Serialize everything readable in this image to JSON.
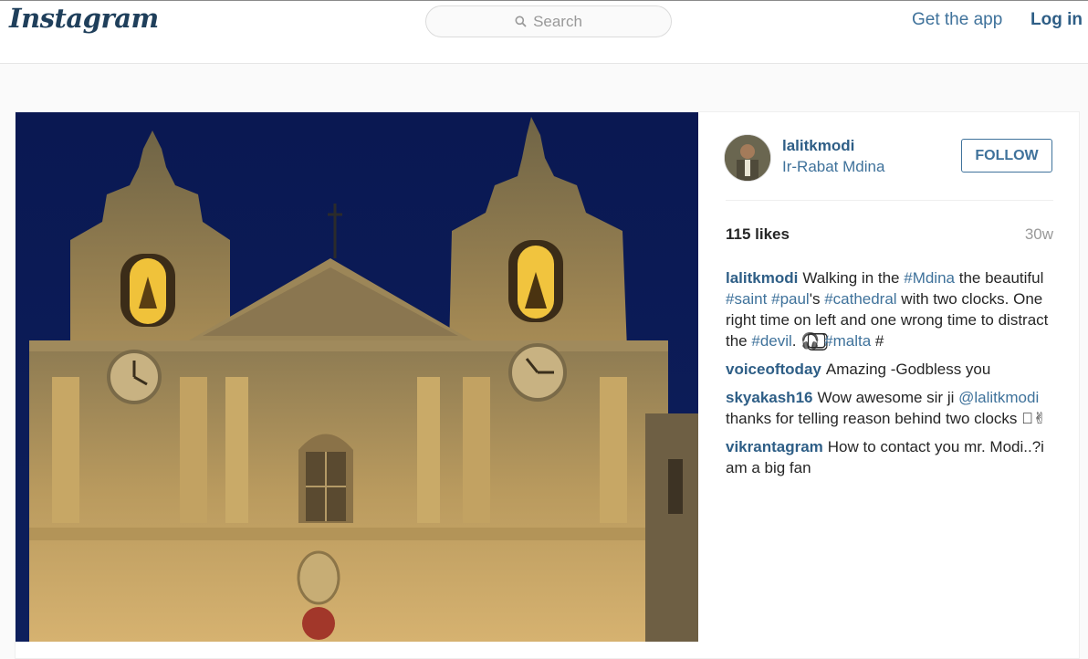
{
  "header": {
    "logo": "Instagram",
    "search_placeholder": "Search",
    "get_app": "Get the app",
    "login": "Log in"
  },
  "post": {
    "user": "lalitkmodi",
    "location": "Ir-Rabat Mdina",
    "follow_label": "FOLLOW",
    "likes": "115 likes",
    "age": "30w",
    "caption": {
      "user": "lalitkmodi",
      "t1": "Walking in the ",
      "tag1": "#Mdina",
      "t2": " the beautiful ",
      "tag2": "#saint",
      "t3": " ",
      "tag3": "#paul",
      "t4": "'s ",
      "tag4": "#cathedral",
      "t5": " with two clocks. One right time on left and one wrong time to distract the ",
      "tag5": "#devil",
      "t6": ". 🎧⃣ ",
      "tag6": "#malta",
      "t7": " #"
    },
    "comments": [
      {
        "user": "voiceoftoday",
        "text": "Amazing -Godbless you"
      },
      {
        "user": "skyakash16",
        "text1": "Wow awesome sir ji ",
        "mention": "@lalitkmodi",
        "text2": " thanks for telling reason behind two clocks ⃣✌"
      },
      {
        "user": "vikrantagram",
        "text": "How to contact you mr. Modi..?i am a big fan"
      }
    ]
  },
  "colors": {
    "link": "#3f729b",
    "username": "#2e5e86",
    "sky": "#0b1a4a",
    "stone": "#c9a866"
  },
  "icons": {
    "search": "search-icon"
  }
}
